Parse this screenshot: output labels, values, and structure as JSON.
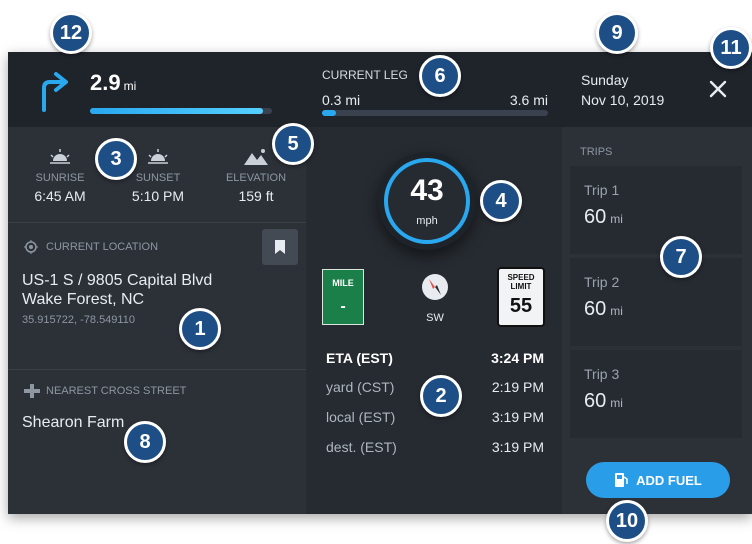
{
  "nav": {
    "distance": "2.9",
    "distance_unit": "mi",
    "turn_icon": "turn-right-arrow-icon"
  },
  "leg": {
    "title": "CURRENT LEG",
    "start": "0.3 mi",
    "end": "3.6 mi",
    "progress": 0.06
  },
  "date": {
    "day": "Sunday",
    "date": "Nov 10, 2019"
  },
  "turn_progress": 0.95,
  "sun": {
    "sunrise_label": "SUNRISE",
    "sunrise": "6:45 AM",
    "sunset_label": "SUNSET",
    "sunset": "5:10 PM",
    "elevation_label": "ELEVATION",
    "elevation": "159 ft"
  },
  "location": {
    "label": "CURRENT LOCATION",
    "address": "US-1 S / 9805 Capital Blvd",
    "city": "Wake Forest, NC",
    "coords": "35.915722, -78.549110"
  },
  "cross_street": {
    "label": "NEAREST CROSS STREET",
    "name": "Shearon Farm"
  },
  "speed": {
    "value": "43",
    "unit": "mph"
  },
  "mile_marker": {
    "label": "MILE",
    "value": "-"
  },
  "compass": {
    "heading": "SW"
  },
  "speed_limit": {
    "label_line1": "SPEED",
    "label_line2": "LIMIT",
    "value": "55"
  },
  "eta": {
    "header_label": "ETA (EST)",
    "header_value": "3:24 PM",
    "rows": [
      {
        "label": "yard (CST)",
        "value": "2:19 PM"
      },
      {
        "label": "local (EST)",
        "value": "3:19 PM"
      },
      {
        "label": "dest. (EST)",
        "value": "3:19 PM"
      }
    ]
  },
  "trips": {
    "title": "TRIPS",
    "items": [
      {
        "name": "Trip 1",
        "value": "60",
        "unit": "mi"
      },
      {
        "name": "Trip 2",
        "value": "60",
        "unit": "mi"
      },
      {
        "name": "Trip 3",
        "value": "60",
        "unit": "mi"
      }
    ]
  },
  "fuel_button": {
    "label": "ADD FUEL"
  },
  "badges": [
    "1",
    "2",
    "3",
    "4",
    "5",
    "6",
    "7",
    "8",
    "9",
    "10",
    "11",
    "12"
  ],
  "colors": {
    "accent": "#29a8f0",
    "badge": "#1d4f86",
    "mile_green": "#1b7f4a",
    "fuel_button": "#2a9de8"
  }
}
